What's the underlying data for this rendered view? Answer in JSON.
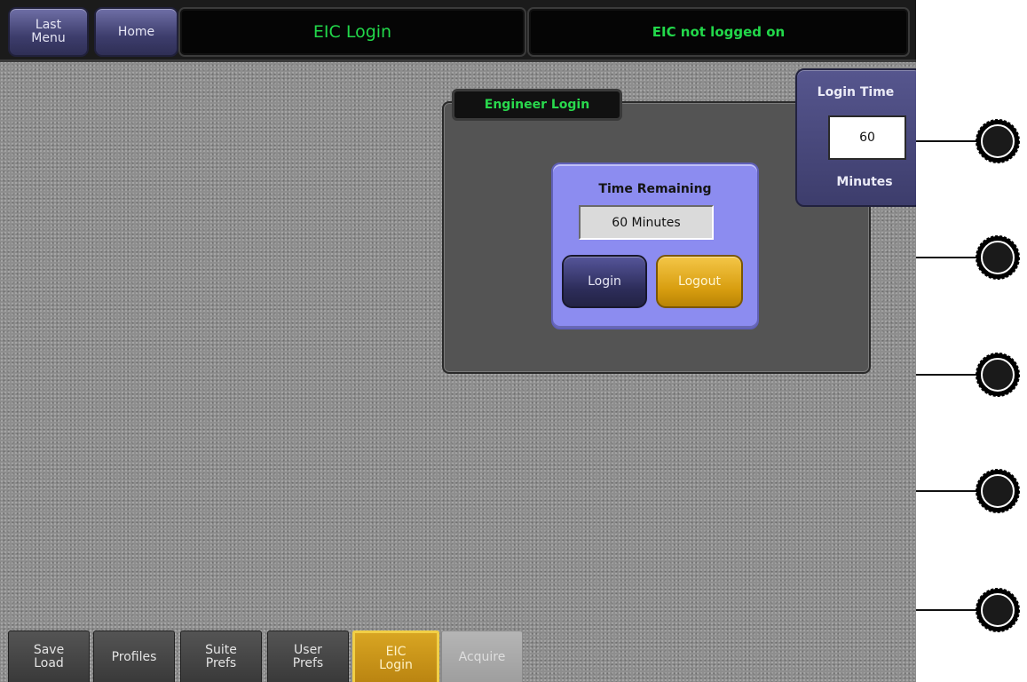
{
  "header": {
    "last_menu_label": "Last\nMenu",
    "home_label": "Home",
    "title": "EIC Login",
    "status": "EIC not logged on"
  },
  "engineer_login": {
    "group_label": "Engineer Login",
    "time_remaining_title": "Time Remaining",
    "time_remaining_value": "60 Minutes",
    "login_label": "Login",
    "logout_label": "Logout"
  },
  "login_time": {
    "title": "Login Time",
    "value": "60",
    "unit": "Minutes"
  },
  "tabs": [
    {
      "label": "Save\nLoad",
      "state": "normal"
    },
    {
      "label": "Profiles",
      "state": "normal"
    },
    {
      "label": "Suite\nPrefs",
      "state": "normal"
    },
    {
      "label": "User\nPrefs",
      "state": "normal"
    },
    {
      "label": "EIC\nLogin",
      "state": "active"
    },
    {
      "label": "Acquire",
      "state": "disabled"
    }
  ],
  "knobs": [
    "knob-1",
    "knob-2",
    "knob-3",
    "knob-4",
    "knob-5"
  ],
  "colors": {
    "status_green": "#22d84a",
    "accent_gold": "#d89e10",
    "panel_lavender": "#8c8cf0",
    "button_navy": "#3d3d6c"
  }
}
